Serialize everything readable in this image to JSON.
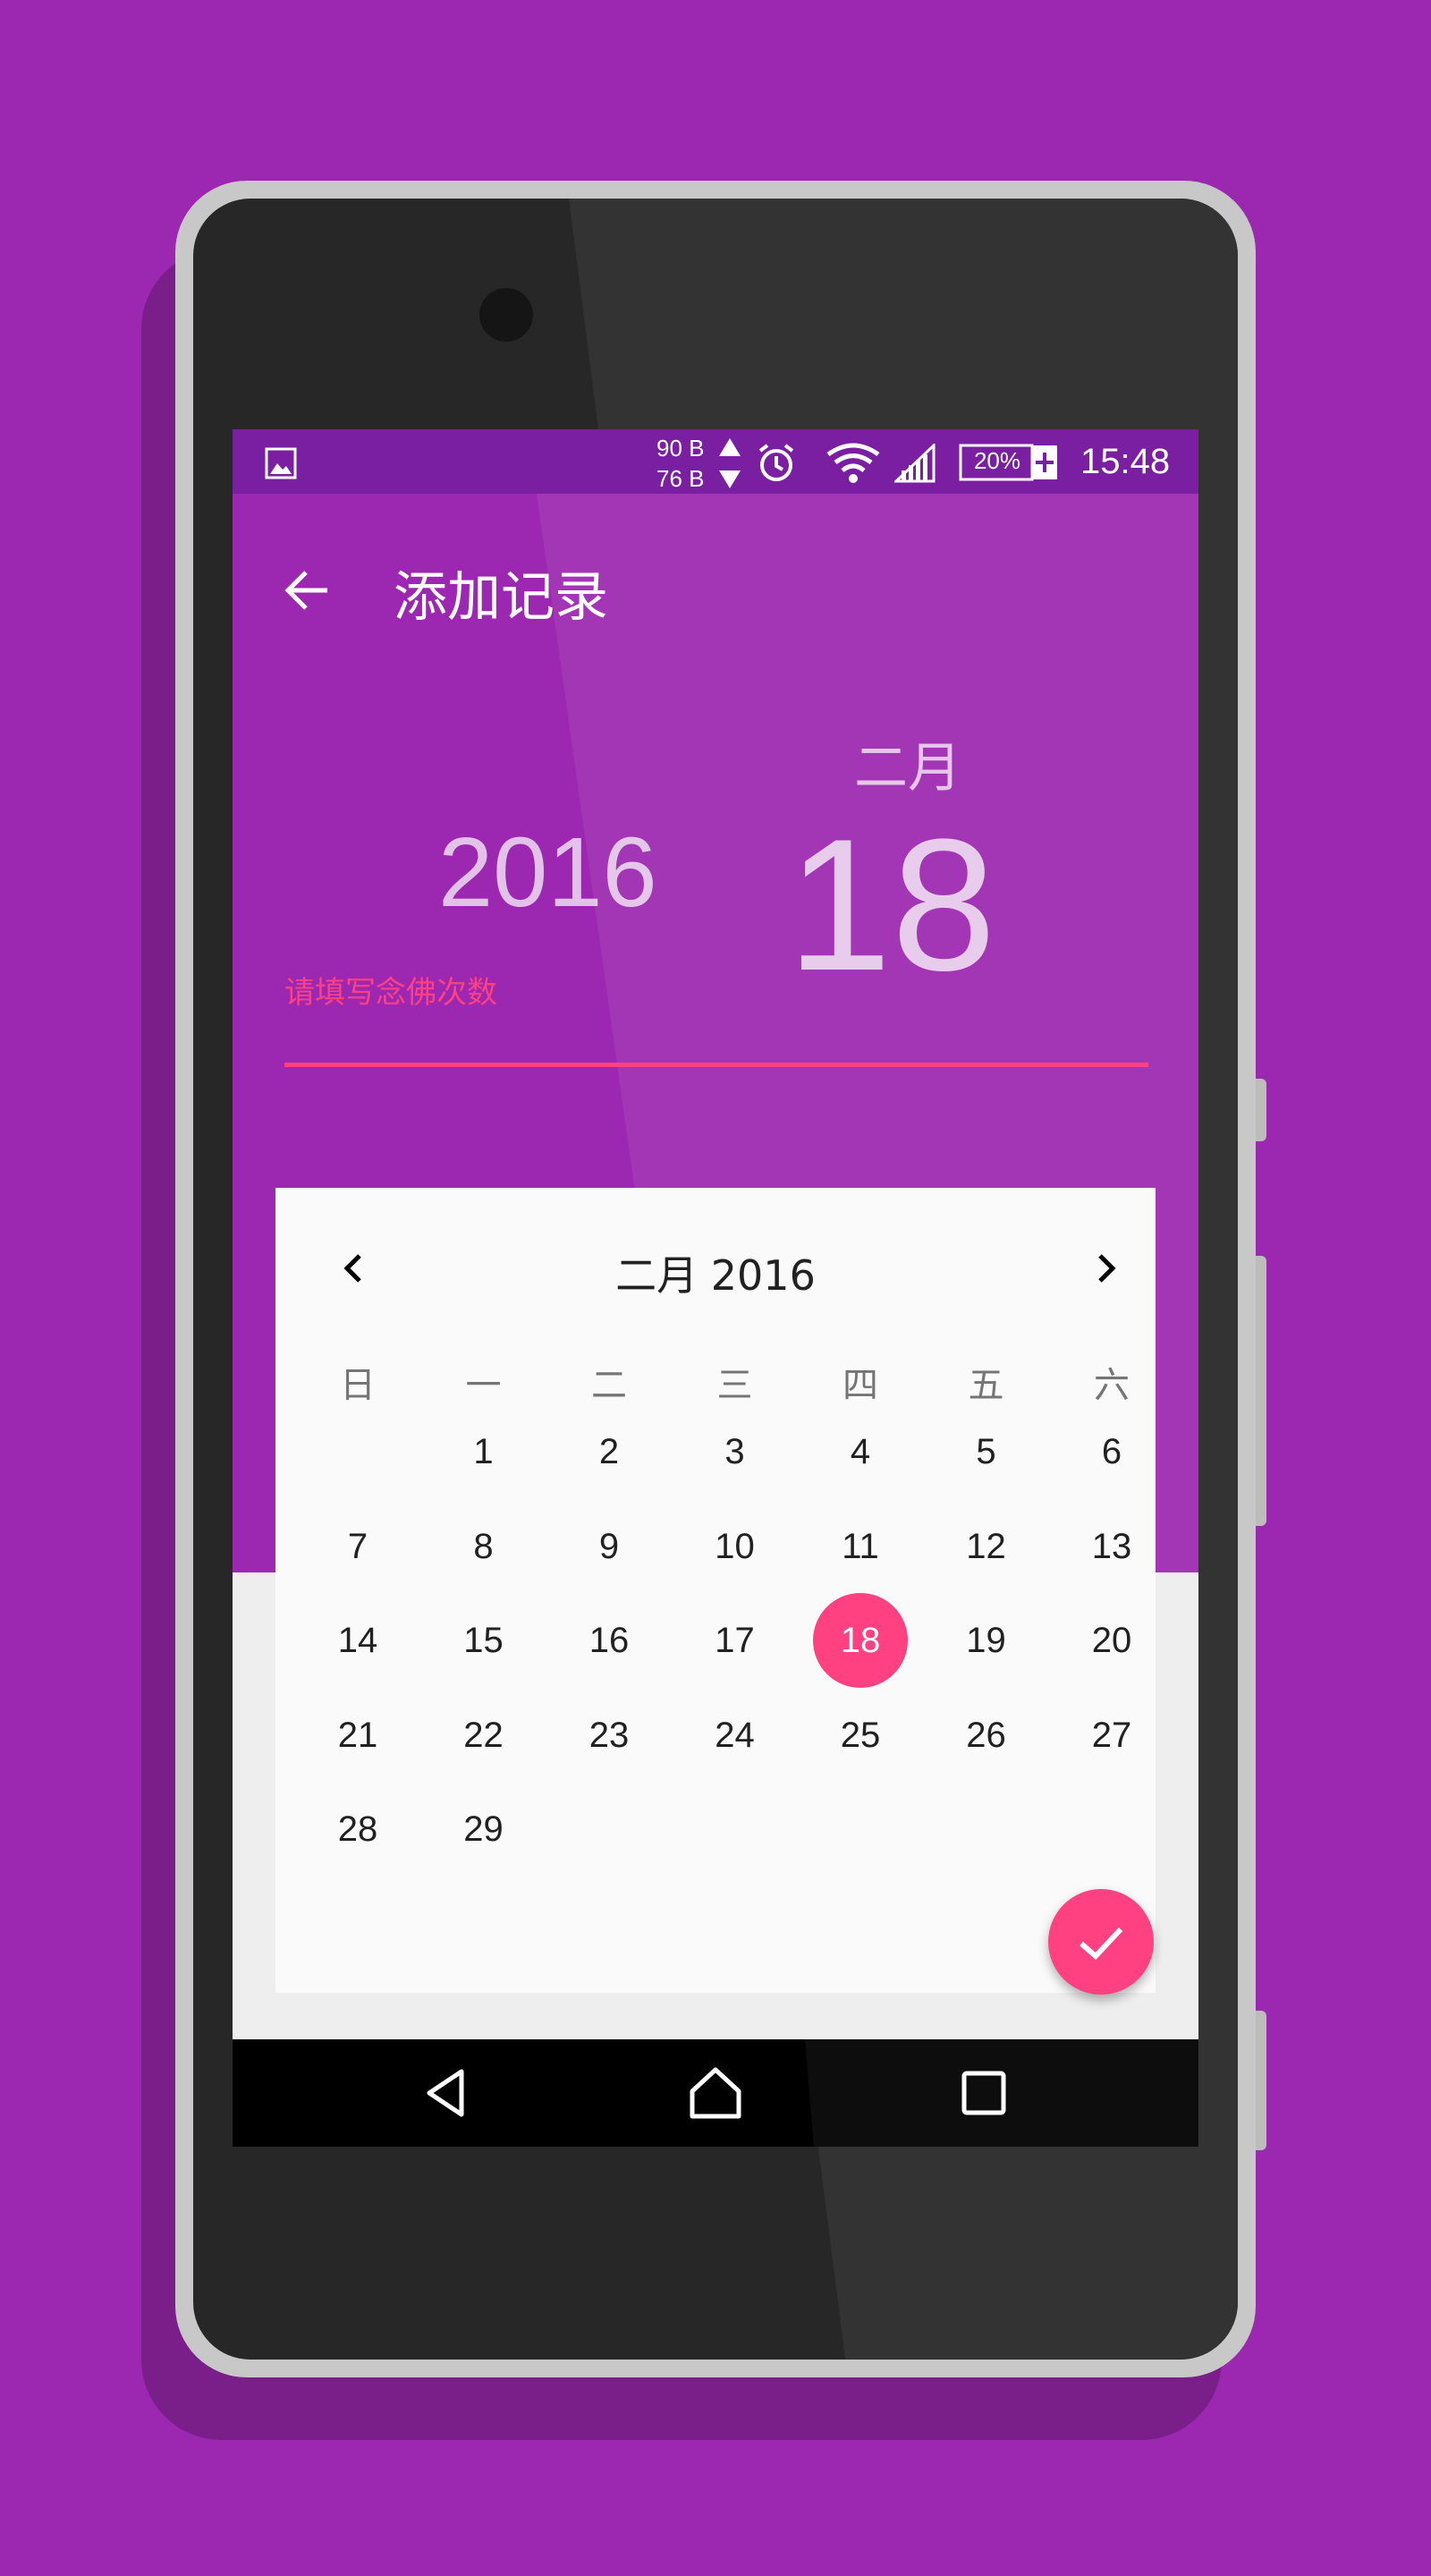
{
  "status_bar": {
    "net_up": "90 B",
    "net_down": "76 B",
    "battery": "20%",
    "time": "15:48",
    "icons": [
      "image-icon",
      "alarm-icon",
      "wifi-icon",
      "signal-icon",
      "battery-icon"
    ]
  },
  "toolbar": {
    "title": "添加记录",
    "back_icon": "arrow-left-icon"
  },
  "header": {
    "month": "二月",
    "year": "2016",
    "day": "18",
    "input_placeholder": "请填写念佛次数"
  },
  "calendar": {
    "title": "二月 2016",
    "weekdays": [
      "日",
      "一",
      "二",
      "三",
      "四",
      "五",
      "六"
    ],
    "selected_day": "18",
    "weeks": [
      [
        "",
        "1",
        "2",
        "3",
        "4",
        "5",
        "6"
      ],
      [
        "7",
        "8",
        "9",
        "10",
        "11",
        "12",
        "13"
      ],
      [
        "14",
        "15",
        "16",
        "17",
        "18",
        "19",
        "20"
      ],
      [
        "21",
        "22",
        "23",
        "24",
        "25",
        "26",
        "27"
      ],
      [
        "28",
        "29",
        "",
        "",
        "",
        "",
        ""
      ]
    ]
  },
  "fab": {
    "icon": "check-icon"
  },
  "nav_bar": {
    "icons": [
      "back-triangle-icon",
      "home-icon",
      "recents-icon"
    ]
  },
  "colors": {
    "background": "#9c27b0",
    "primary_dark": "#7b1fa2",
    "accent": "#ff4081",
    "calendar_bg": "#fafafa"
  }
}
